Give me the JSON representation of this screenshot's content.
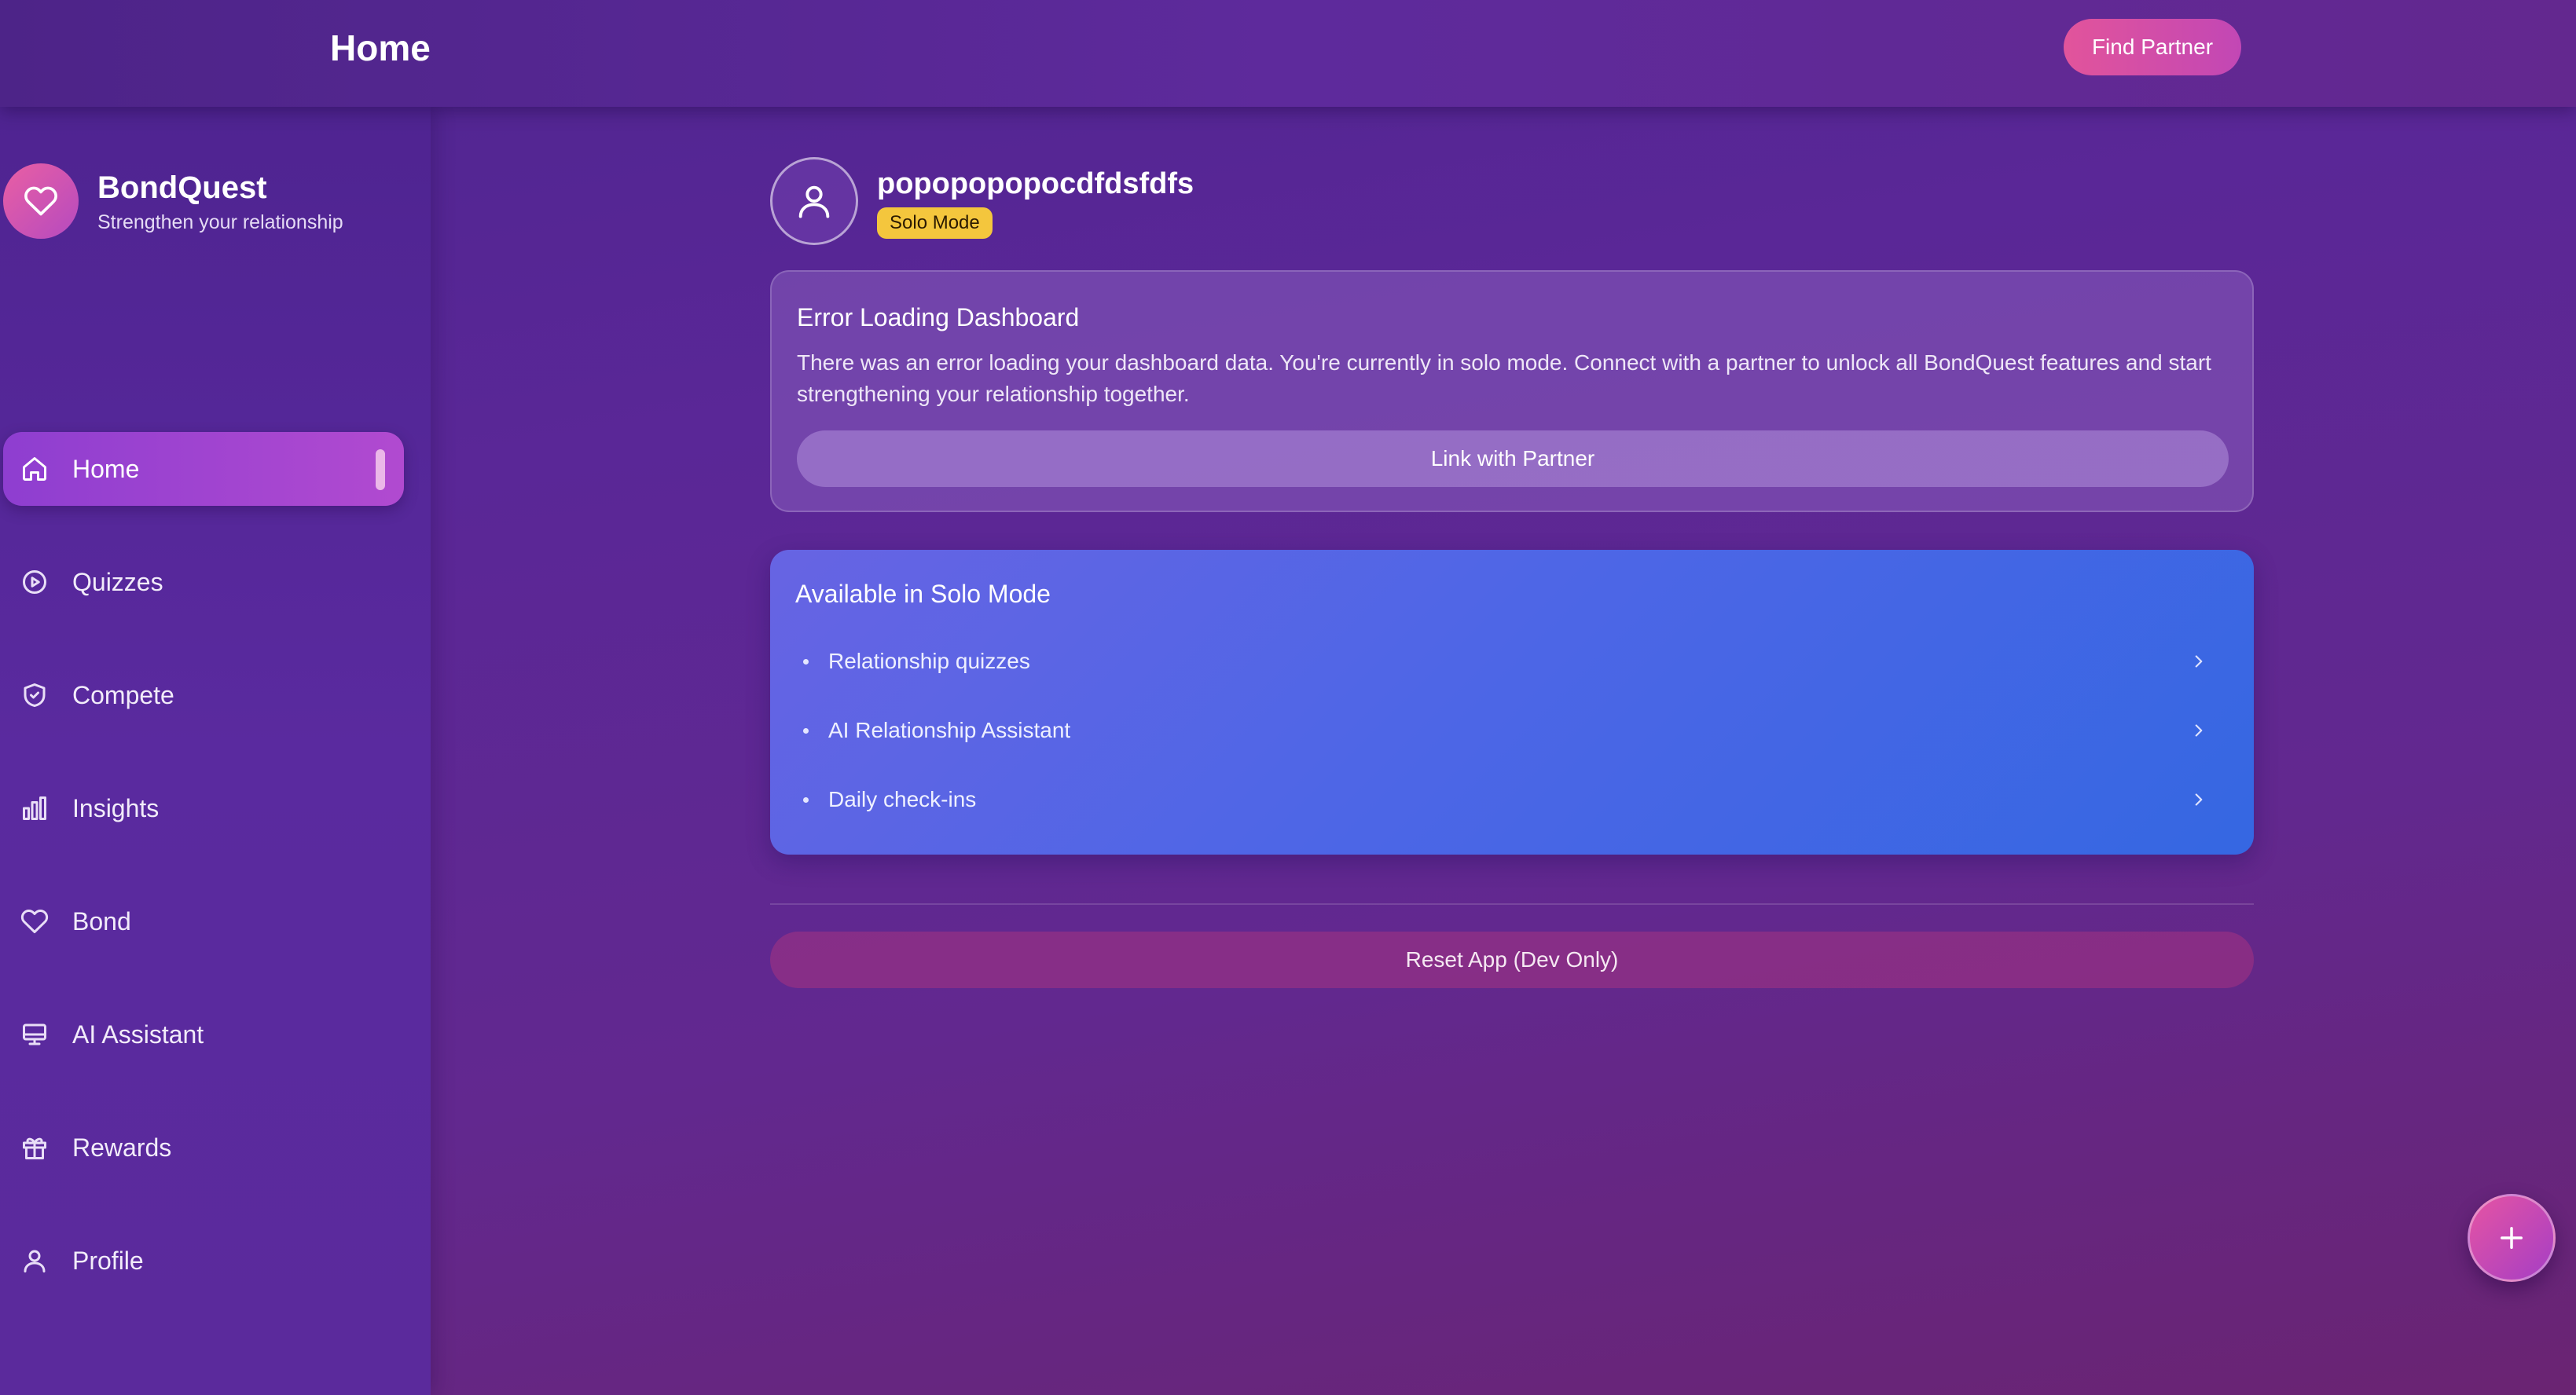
{
  "header": {
    "title": "Home",
    "find_partner_label": "Find Partner"
  },
  "brand": {
    "name": "BondQuest",
    "tagline": "Strengthen your relationship",
    "logo_icon": "heart-icon"
  },
  "sidebar": {
    "items": [
      {
        "label": "Home",
        "icon": "home-icon",
        "active": true
      },
      {
        "label": "Quizzes",
        "icon": "play-circle-icon",
        "active": false
      },
      {
        "label": "Compete",
        "icon": "shield-icon",
        "active": false
      },
      {
        "label": "Insights",
        "icon": "bar-chart-icon",
        "active": false
      },
      {
        "label": "Bond",
        "icon": "heart-icon",
        "active": false
      },
      {
        "label": "AI Assistant",
        "icon": "monitor-icon",
        "active": false
      },
      {
        "label": "Rewards",
        "icon": "gift-icon",
        "active": false
      },
      {
        "label": "Profile",
        "icon": "user-icon",
        "active": false
      }
    ]
  },
  "profile": {
    "username": "popopopopocdfdsfdfs",
    "mode_badge": "Solo Mode"
  },
  "error_card": {
    "title": "Error Loading Dashboard",
    "message": "There was an error loading your dashboard data. You're currently in solo mode. Connect with a partner to unlock all BondQuest features and start strengthening your relationship together.",
    "button_label": "Link with Partner"
  },
  "solo_card": {
    "title": "Available in Solo Mode",
    "items": [
      {
        "label": "Relationship quizzes"
      },
      {
        "label": "AI Relationship Assistant"
      },
      {
        "label": "Daily check-ins"
      }
    ]
  },
  "reset_button_label": "Reset App (Dev Only)",
  "colors": {
    "accent_pink": "#e2549b",
    "badge_yellow": "#f4c63d",
    "solo_card_blue": "#4e66e6",
    "active_nav_purple": "#9c44d0"
  }
}
